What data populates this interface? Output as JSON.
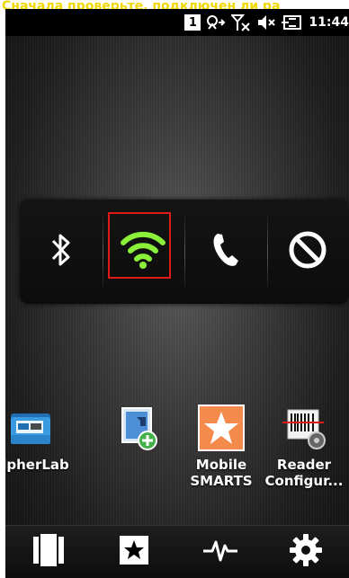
{
  "caption": "Сначала проверьте, подключен ли ра",
  "status_bar": {
    "sim_number": "1",
    "time": "11:44",
    "icons": [
      "data-sync-icon",
      "no-signal-icon",
      "speaker-muted-icon",
      "battery-charging-icon"
    ]
  },
  "quick_settings": {
    "items": [
      {
        "name": "bluetooth-icon",
        "state": "off"
      },
      {
        "name": "wifi-icon",
        "state": "on"
      },
      {
        "name": "phone-icon",
        "state": "off"
      },
      {
        "name": "do-not-disturb-icon",
        "state": "off"
      }
    ],
    "accent_color": "#8bf03a",
    "highlight_color": "#e01919"
  },
  "apps": [
    {
      "label": "CipherLab",
      "icon": "cipherlab-folder-icon"
    },
    {
      "label": "",
      "icon": "shortcut-add-icon"
    },
    {
      "label_line1": "Mobile",
      "label_line2": "SMARTS",
      "icon": "mobile-smarts-icon"
    },
    {
      "label_line1": "Reader",
      "label_line2": "Configur...",
      "icon": "reader-config-icon"
    }
  ],
  "dock": {
    "items": [
      "apps-icon",
      "favorites-icon",
      "activity-icon",
      "settings-icon"
    ]
  }
}
